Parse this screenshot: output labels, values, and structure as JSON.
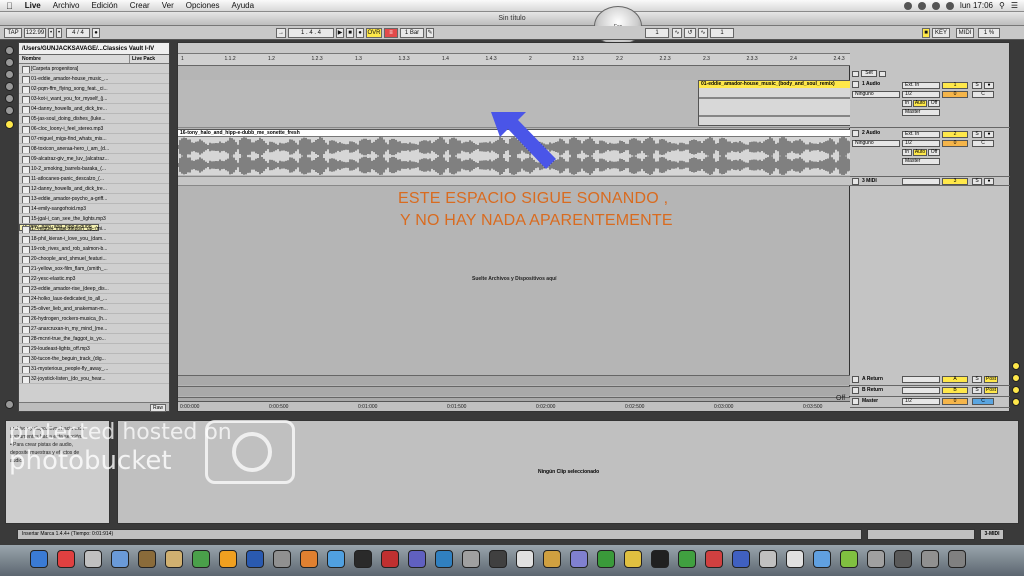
{
  "menubar": {
    "items": [
      "Live",
      "Archivo",
      "Edición",
      "Crear",
      "Ver",
      "Opciones",
      "Ayuda"
    ],
    "clock": "lun 17:06"
  },
  "window": {
    "title": "Sin título",
    "esc": "Esc"
  },
  "transport": {
    "tap": "TAP",
    "tempo": "122.99",
    "sig": "4 / 4",
    "position": "1 . 4 . 4",
    "ovr": "OVR",
    "quant": "1 Bar",
    "key": "KEY",
    "midi": "MIDI",
    "pct": "1 %"
  },
  "browser": {
    "path": "/Users/GUNJACKSAVAGE/...Classics Vault I-IV",
    "col_name": "Nombre",
    "col_pack": "Live Pack",
    "files": [
      "[Carpeta progenitora]",
      "01-eddie_amador-house_music_...",
      "02-pqm-ffm_flying_song_feat._ci...",
      "03-kot-i_want_you_for_myself_(j...",
      "04-danny_howells_and_dick_tre...",
      "05-jas-soul_doing_dishes_(luke...",
      "06-cloc_loony-i_feel_stereo.mp3",
      "07-miguel_migs-find_whats_mis...",
      "08-toxicon_aneraa-hero_i_am_(d...",
      "09-alcatraz-giv_me_luv_(alcatraz...",
      "10-2_smoking_barrels-baraka_(...",
      "11-atlocanes-panic_descalzo_(...",
      "12-danny_howells_and_dick_tre...",
      "13-eddie_amador-psycho_a-griff...",
      "14-emily-sangofroid.mp3",
      "15-jgal-i_can_see_the_lights.mp3",
      "16-tony_halo_and_hipp-e-dubb_...",
      "17-miguel_migs-steppin_up_(mi...",
      "18-phil_kieran-i_love_you_(dam...",
      "19-rob_rives_and_rob_salmon-b...",
      "20-choople_and_shmuel_featuri...",
      "21-yellow_sox-film_flam_(smith_...",
      "22-yesc-elastic.mp3",
      "23-eddie_amador-rise_(deep_dis...",
      "24-holko_laux-dedicated_to_all_...",
      "25-oliver_lieb_and_snakeman-m...",
      "26-hydrogen_rockers-musica_(h...",
      "27-anarcruxan-in_my_mind_(me...",
      "28-mcnri-true_the_faggot_is_yo...",
      "29-loudeast-lights_off.mp3",
      "30-tucon-the_beguin_track_(dig...",
      "31-mysterious_people-fly_away_...",
      "32-joystick-listen_(do_you_hear..."
    ],
    "raw": "Raw"
  },
  "ruler": {
    "bars": [
      "1",
      "1.1.2",
      "1.2",
      "1.2.3",
      "1.3",
      "1.3.3",
      "1.4",
      "1.4.3",
      "2",
      "2.1.3",
      "2.2",
      "2.2.3",
      "2.3",
      "2.3.3",
      "2.4",
      "2.4.3"
    ],
    "times": [
      "0:00:000",
      "0:00:500",
      "0:01:000",
      "0:01:500",
      "0:02:000",
      "0:02:500",
      "0:03:000",
      "0:03:500"
    ]
  },
  "tracks": {
    "clip1_name": "01-eddie_amador-house_music_(body_and_soul_remix)",
    "clip2_name": "16-tony_halo_and_hipp-e-dubb_me_sonette_fresh",
    "t1_name": "1 Audio",
    "t2_name": "2 Audio",
    "t3_name": "3 MIDI",
    "ext_in": "Ext. In",
    "ninguno": "Ninguno",
    "ch": "1/2",
    "master": "Master",
    "n1": "1",
    "n2": "2",
    "n3": "3",
    "zero": "0",
    "c": "C",
    "s": "S",
    "auto": "Auto",
    "in": "In",
    "off": "Off",
    "ret_a": "A Return",
    "ret_b": "B Return",
    "master_tr": "Master",
    "a": "A",
    "b": "B",
    "post": "Post",
    "set": "Set"
  },
  "annotation": {
    "line1": "ESTE ESPACIO SIGUE SONANDO ,",
    "line2": "Y NO HAY NADA APARENTEMENTE"
  },
  "drop_hint": "Suelte Archivos y Dispositivos aquí",
  "info_text": [
    "archivos y dispositivos hacia esta",
    "instrumentos hacia esta sección.",
    "• Para crear pistas de audio,",
    "deposite muestras y efectos de",
    "audio."
  ],
  "detail_msg": "Ningún Clip seleccionado",
  "status": "Insertar Marca 1.4.4+ (Tiempo: 0:01:914)",
  "midi_status": "3-MIDI",
  "watermark": {
    "line1": "protected hosted on",
    "line2": "photobucket"
  },
  "accent": {
    "yellow": "#ffe84a",
    "orange": "#d96b1f",
    "blue": "#4a55e8"
  }
}
